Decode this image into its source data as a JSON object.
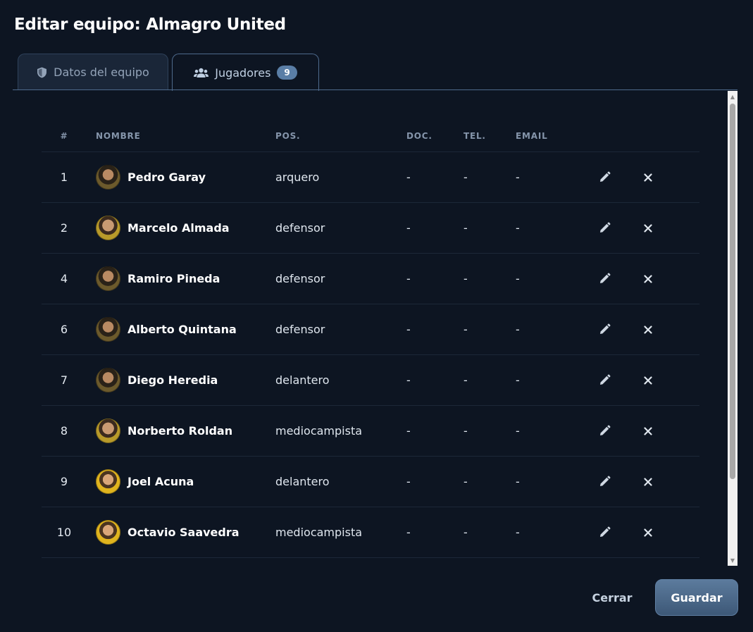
{
  "modal": {
    "title": "Editar equipo: Almagro United"
  },
  "tabs": [
    {
      "label": "Datos del equipo",
      "icon": "shield-icon"
    },
    {
      "label": "Jugadores",
      "icon": "users-icon",
      "badge": "9"
    }
  ],
  "table": {
    "headers": {
      "num": "#",
      "nombre": "NOMBRE",
      "pos": "POS.",
      "doc": "DOC.",
      "tel": "TEL.",
      "email": "EMAIL"
    },
    "rows": [
      {
        "num": "1",
        "nombre": "Pedro Garay",
        "pos": "arquero",
        "doc": "-",
        "tel": "-",
        "email": "-"
      },
      {
        "num": "2",
        "nombre": "Marcelo Almada",
        "pos": "defensor",
        "doc": "-",
        "tel": "-",
        "email": "-"
      },
      {
        "num": "4",
        "nombre": "Ramiro Pineda",
        "pos": "defensor",
        "doc": "-",
        "tel": "-",
        "email": "-"
      },
      {
        "num": "6",
        "nombre": "Alberto Quintana",
        "pos": "defensor",
        "doc": "-",
        "tel": "-",
        "email": "-"
      },
      {
        "num": "7",
        "nombre": "Diego Heredia",
        "pos": "delantero",
        "doc": "-",
        "tel": "-",
        "email": "-"
      },
      {
        "num": "8",
        "nombre": "Norberto Roldan",
        "pos": "mediocampista",
        "doc": "-",
        "tel": "-",
        "email": "-"
      },
      {
        "num": "9",
        "nombre": "Joel Acuna",
        "pos": "delantero",
        "doc": "-",
        "tel": "-",
        "email": "-"
      },
      {
        "num": "10",
        "nombre": "Octavio Saavedra",
        "pos": "mediocampista",
        "doc": "-",
        "tel": "-",
        "email": "-"
      }
    ]
  },
  "footer": {
    "cancel_label": "Cerrar",
    "save_label": "Guardar"
  },
  "colors": {
    "background": "#0d1522",
    "accent": "#5a7ea6",
    "tab_border": "#4e6a8c"
  }
}
